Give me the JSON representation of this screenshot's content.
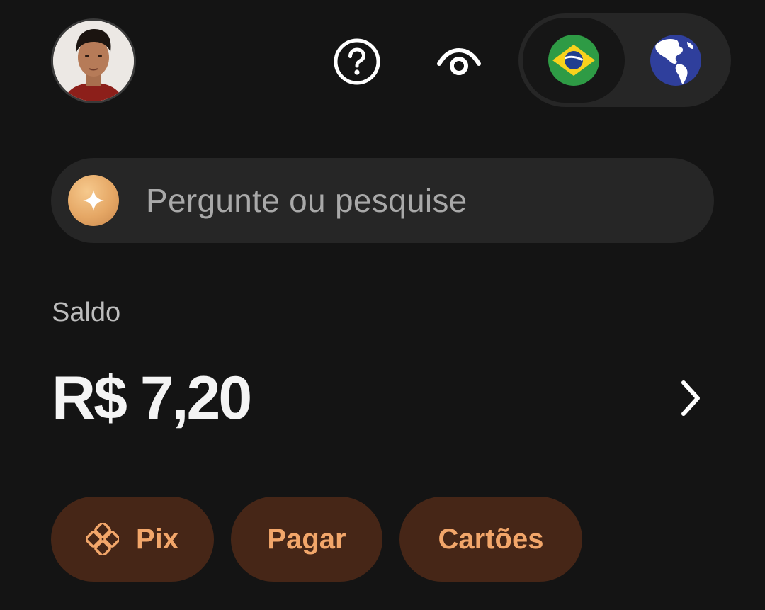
{
  "header": {
    "avatar": "user-avatar-photo",
    "help_icon": "question-circle-icon",
    "visibility_icon": "eye-icon",
    "region_toggle": {
      "options": [
        {
          "name": "brazil-flag-icon",
          "selected": true
        },
        {
          "name": "globe-icon",
          "selected": false
        }
      ]
    }
  },
  "search": {
    "placeholder": "Pergunte ou pesquise",
    "icon": "sparkle-icon"
  },
  "balance": {
    "label": "Saldo",
    "value": "R$ 7,20",
    "chevron_icon": "chevron-right-icon"
  },
  "actions": [
    {
      "label": "Pix",
      "icon": "pix-icon"
    },
    {
      "label": "Pagar"
    },
    {
      "label": "Cartões"
    }
  ],
  "colors": {
    "background": "#141414",
    "surface": "#262626",
    "pill_background": "#462617",
    "pill_text": "#f2a66a",
    "accent_gold": "#e5a765"
  }
}
